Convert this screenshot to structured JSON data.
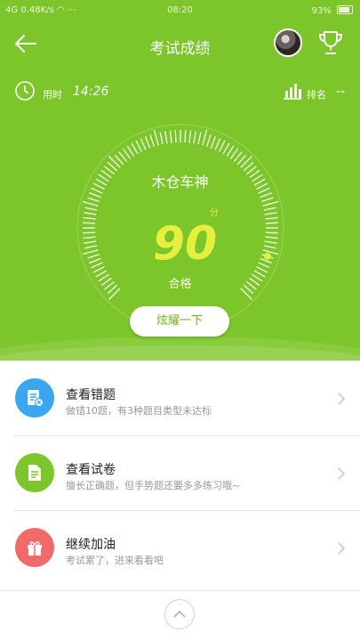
{
  "status_bar": {
    "signal": "4G",
    "speed": "0.48K/s",
    "time": "08:20",
    "battery": "93%"
  },
  "header": {
    "title": "考试成绩"
  },
  "stats": {
    "time_label": "用时",
    "time_value": "14:26",
    "rank_label": "排名",
    "rank_value": "--"
  },
  "result": {
    "name": "木仓车神",
    "score": "90",
    "unit": "分",
    "status": "合格",
    "gauge_fraction": 0.9
  },
  "brag_button": "炫耀一下",
  "items": [
    {
      "title": "查看错题",
      "subtitle": "做错10题，有3种题目类型未达标",
      "icon": "wrong-questions-icon",
      "color": "#3aa6f0"
    },
    {
      "title": "查看试卷",
      "subtitle": "擅长正确题，但手势题还要多多练习哦~",
      "icon": "paper-icon",
      "color": "#7cc52a"
    },
    {
      "title": "继续加油",
      "subtitle": "考试累了，进来看看吧",
      "icon": "gift-icon",
      "color": "#f06a6a"
    }
  ],
  "colors": {
    "primary": "#7cc52a",
    "score": "#e4f03d"
  }
}
